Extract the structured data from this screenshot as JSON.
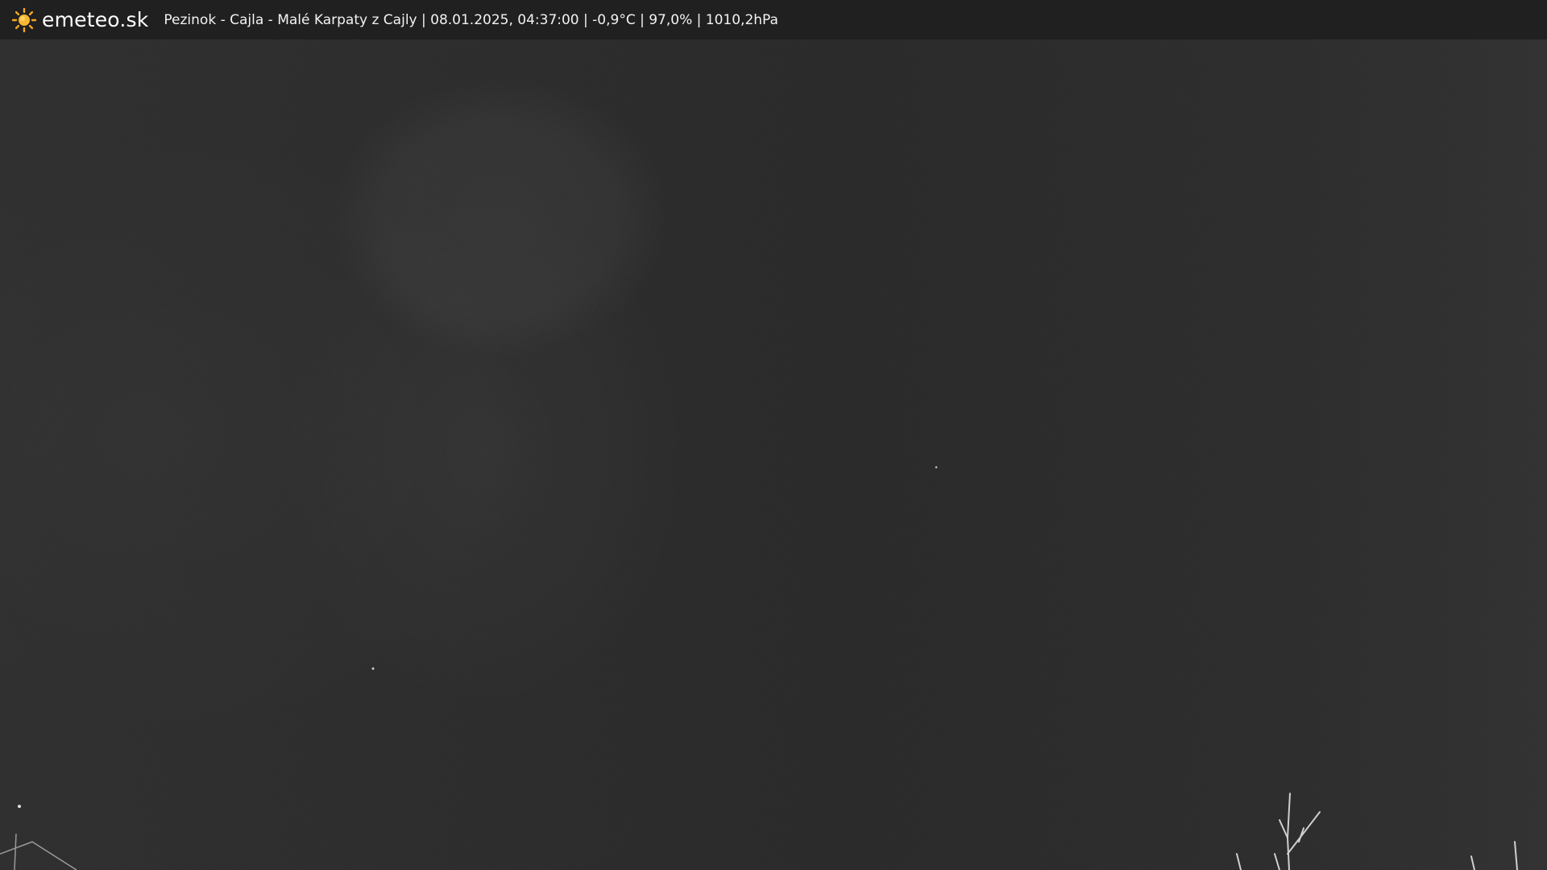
{
  "app": {
    "logo_text": "emeteo.sk",
    "logo_icon": "sun-icon",
    "accent_color": "#f5a623"
  },
  "webcam": {
    "caption": "Pezinok - Cajla - Malé Karpaty z Cajly | 08.01.2025, 04:37:00 | -0,9°C | 97,0% | 1010,2hPa"
  }
}
